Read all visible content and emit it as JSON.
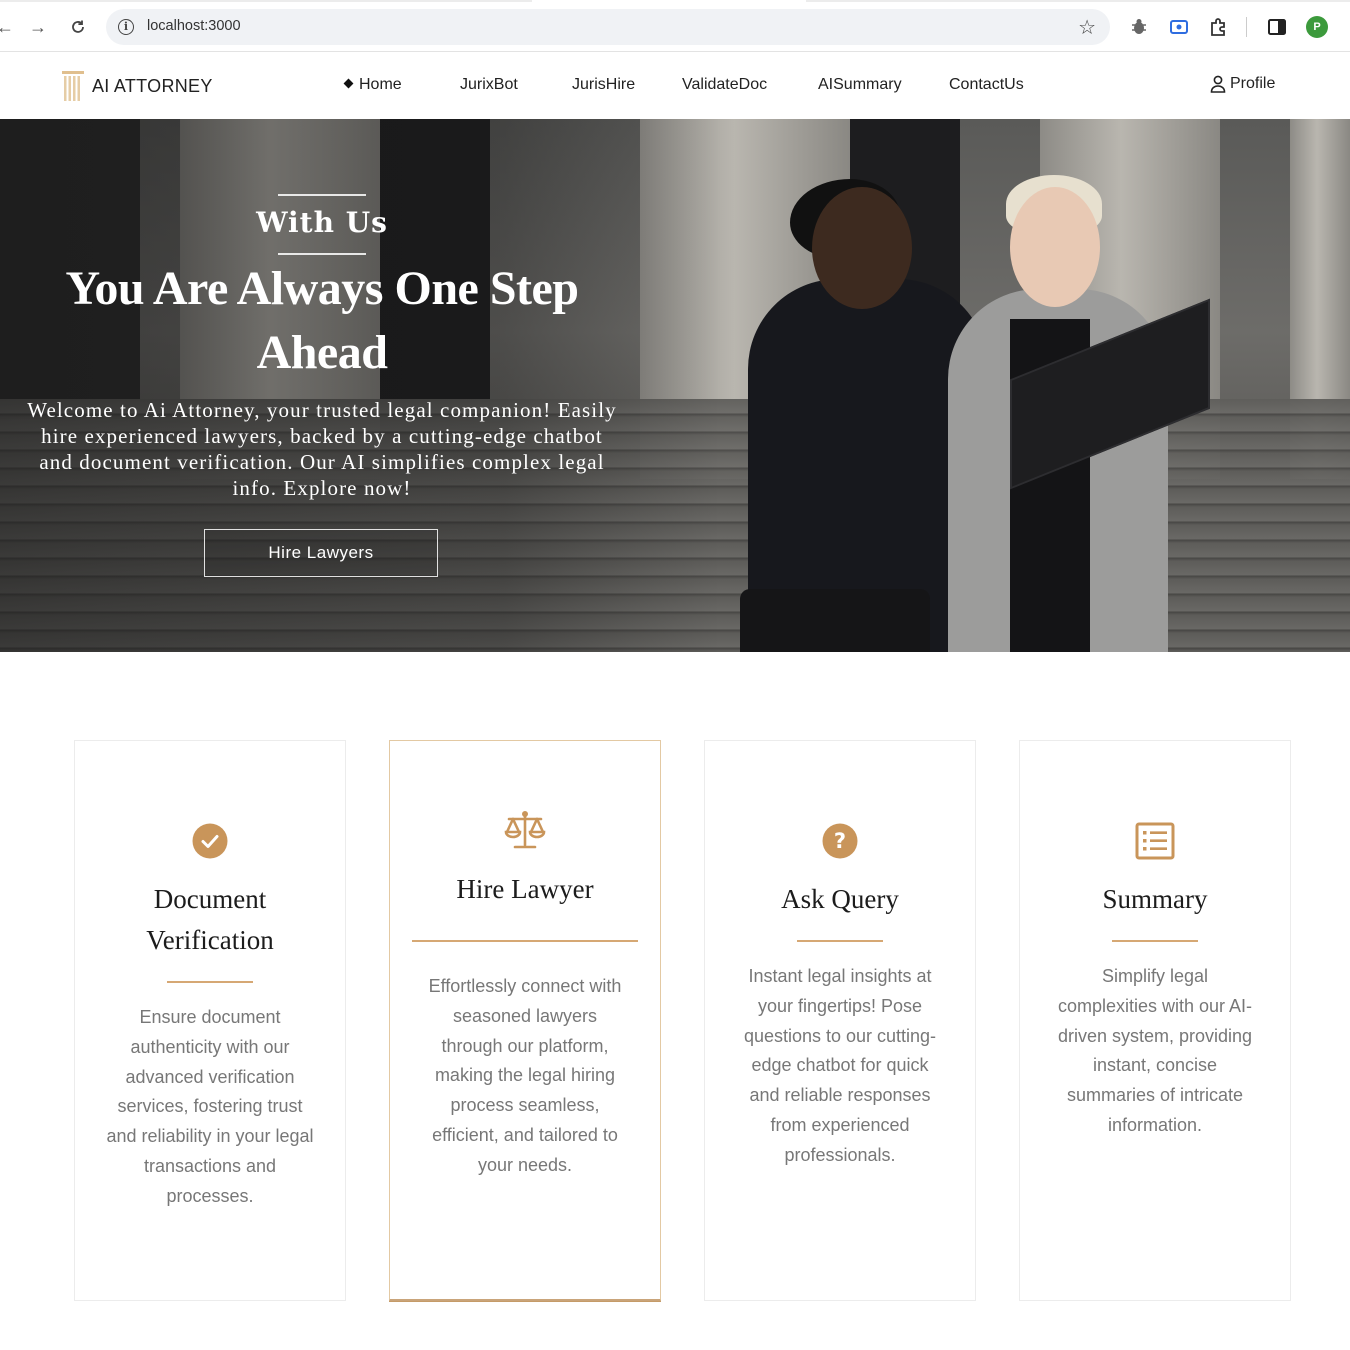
{
  "browser": {
    "url": "localhost:3000",
    "profile_initial": "P"
  },
  "header": {
    "logo_text": "AI ATTORNEY",
    "nav": [
      {
        "label": "Home",
        "active": true
      },
      {
        "label": "JurixBot"
      },
      {
        "label": "JurisHire"
      },
      {
        "label": "ValidateDoc"
      },
      {
        "label": "AISummary"
      },
      {
        "label": "ContactUs"
      }
    ],
    "profile_label": "Profile"
  },
  "hero": {
    "kicker": "With Us",
    "title": "You Are Always One Step Ahead",
    "description": "Welcome to Ai Attorney, your trusted legal companion! Easily hire experienced lawyers, backed by a cutting-edge chatbot and document verification. Our AI simplifies complex legal info. Explore now!",
    "button_label": "Hire Lawyers"
  },
  "cards": [
    {
      "icon": "check-circle-icon",
      "title": "Document Verification",
      "text": "Ensure document authenticity with our advanced verification services, fostering trust and reliability in your legal transactions and processes."
    },
    {
      "icon": "scales-icon",
      "title": "Hire Lawyer",
      "text": "Effortlessly connect with seasoned lawyers through our platform, making the legal hiring process seamless, efficient, and tailored to your needs."
    },
    {
      "icon": "question-circle-icon",
      "title": "Ask Query",
      "text": "Instant legal insights at your fingertips! Pose questions to our cutting-edge chatbot for quick and reliable responses from experienced professionals."
    },
    {
      "icon": "list-icon",
      "title": "Summary",
      "text": "Simplify legal complexities with our AI-driven system, providing instant, concise summaries of intricate information."
    }
  ],
  "colors": {
    "accent": "#c9955a",
    "text_muted": "#777777",
    "header_text": "#222222"
  }
}
